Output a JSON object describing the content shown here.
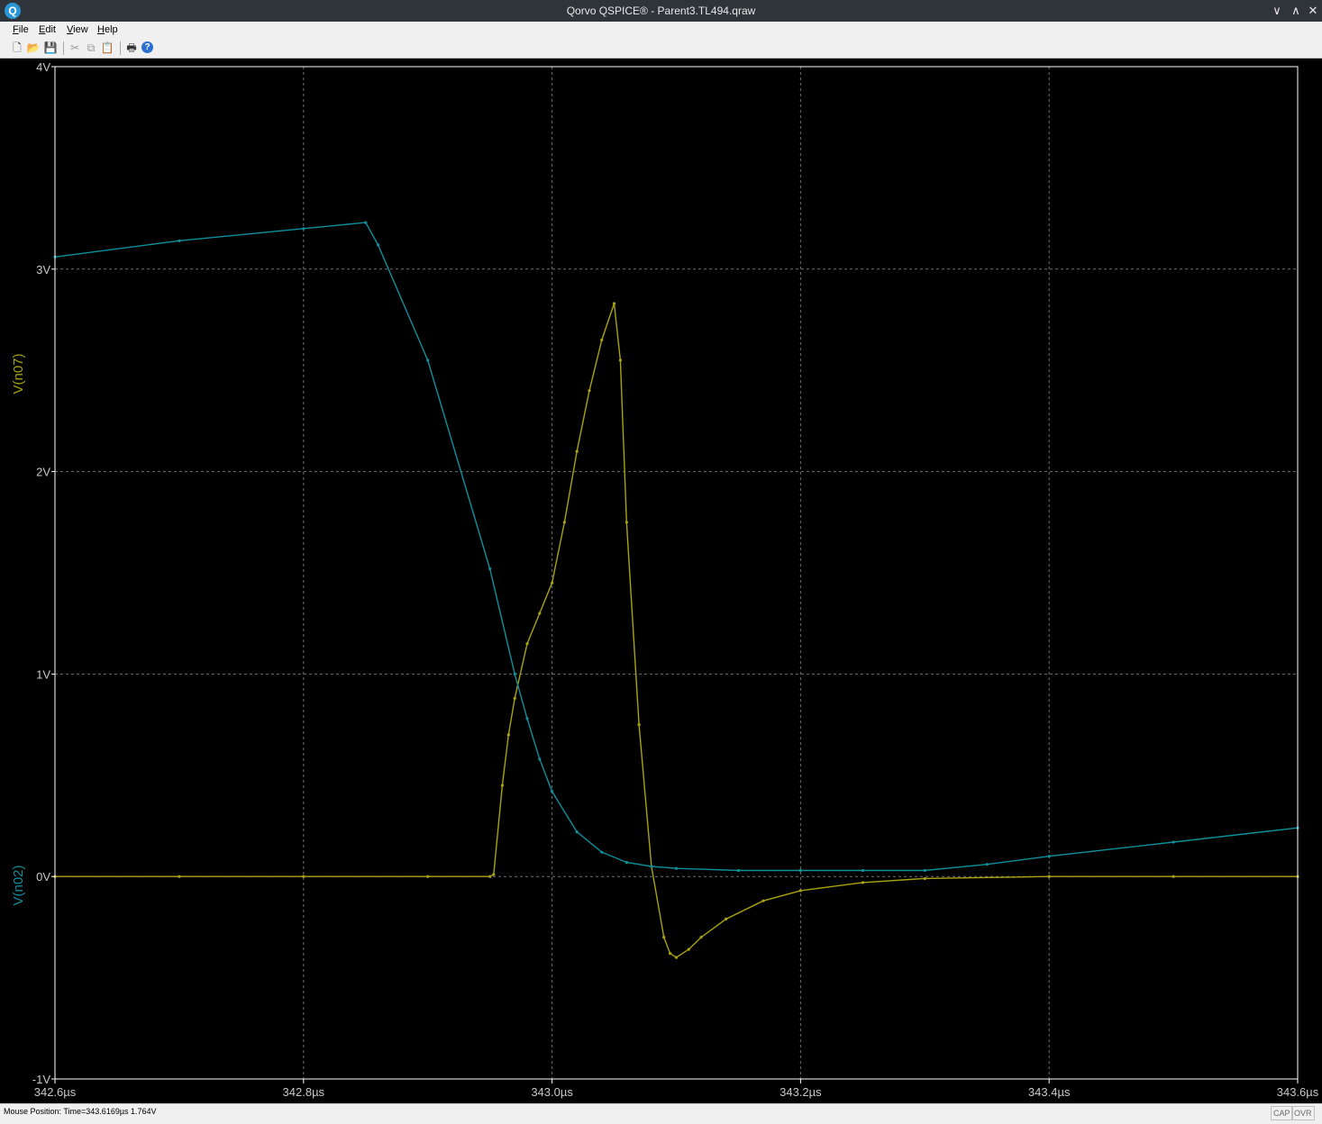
{
  "window": {
    "title": "Qorvo QSPICE® - Parent3.TL494.qraw",
    "logo_letter": "Q",
    "minimize_icon": "chevron-down-icon",
    "maximize_icon": "chevron-up-icon",
    "close_icon": "close-icon",
    "minimize_glyph": "∨",
    "maximize_glyph": "∧",
    "close_glyph": "✕"
  },
  "menu": {
    "file": {
      "mn": "F",
      "rest": "ile"
    },
    "edit": {
      "mn": "E",
      "rest": "dit"
    },
    "view": {
      "mn": "V",
      "rest": "iew"
    },
    "help": {
      "mn": "H",
      "rest": "elp"
    }
  },
  "toolbar": {
    "new_glyph": "🗋",
    "open_glyph": "📂",
    "save_glyph": "💾",
    "cut_glyph": "✂",
    "copy_glyph": "⧉",
    "paste_glyph": "📋",
    "print_glyph": "🖶",
    "help_glyph": "?"
  },
  "status": {
    "mouse_position": "Mouse Position: Time=343.6169µs  1.764V",
    "cap": "CAP",
    "ovr": "OVR"
  },
  "colors": {
    "background": "#000000",
    "axis": "#ffffff",
    "grid": "#707070",
    "n02": "#0f8f9a",
    "n07": "#aaa310"
  },
  "chart_data": {
    "type": "line",
    "x_unit": "µs",
    "y_unit": "V",
    "xlim": [
      342.6,
      343.6
    ],
    "ylim": [
      -1,
      4
    ],
    "x_ticks": [
      {
        "value": 342.6,
        "label": "342.6µs"
      },
      {
        "value": 342.8,
        "label": "342.8µs"
      },
      {
        "value": 343.0,
        "label": "343.0µs"
      },
      {
        "value": 343.2,
        "label": "343.2µs"
      },
      {
        "value": 343.4,
        "label": "343.4µs"
      },
      {
        "value": 343.6,
        "label": "343.6µs"
      }
    ],
    "y_ticks": [
      {
        "value": -1,
        "label": "-1V"
      },
      {
        "value": 0,
        "label": "0V"
      },
      {
        "value": 1,
        "label": "1V"
      },
      {
        "value": 2,
        "label": "2V"
      },
      {
        "value": 3,
        "label": "3V"
      },
      {
        "value": 4,
        "label": "4V"
      }
    ],
    "grid": true,
    "series": [
      {
        "name": "V(n07)",
        "color": "#aaa310",
        "x": [
          342.6,
          342.7,
          342.8,
          342.9,
          342.95,
          342.953,
          342.96,
          342.965,
          342.97,
          342.98,
          342.99,
          343.0,
          343.01,
          343.02,
          343.03,
          343.04,
          343.05,
          343.055,
          343.06,
          343.07,
          343.08,
          343.09,
          343.095,
          343.1,
          343.11,
          343.12,
          343.14,
          343.17,
          343.2,
          343.25,
          343.3,
          343.4,
          343.5,
          343.6
        ],
        "y": [
          0,
          0,
          0,
          0,
          0,
          0.01,
          0.45,
          0.7,
          0.88,
          1.15,
          1.3,
          1.45,
          1.75,
          2.1,
          2.4,
          2.65,
          2.83,
          2.55,
          1.75,
          0.75,
          0.05,
          -0.3,
          -0.38,
          -0.4,
          -0.36,
          -0.3,
          -0.21,
          -0.12,
          -0.07,
          -0.03,
          -0.01,
          0,
          0,
          0
        ]
      },
      {
        "name": "V(n02)",
        "color": "#0f8f9a",
        "x": [
          342.6,
          342.7,
          342.8,
          342.85,
          342.86,
          342.9,
          342.95,
          342.97,
          342.98,
          342.99,
          343.0,
          343.02,
          343.04,
          343.06,
          343.08,
          343.1,
          343.15,
          343.2,
          343.25,
          343.3,
          343.35,
          343.4,
          343.5,
          343.6
        ],
        "y": [
          3.06,
          3.14,
          3.2,
          3.23,
          3.12,
          2.55,
          1.52,
          1.0,
          0.78,
          0.58,
          0.42,
          0.22,
          0.12,
          0.07,
          0.05,
          0.04,
          0.03,
          0.03,
          0.03,
          0.03,
          0.06,
          0.1,
          0.17,
          0.24
        ]
      }
    ]
  }
}
